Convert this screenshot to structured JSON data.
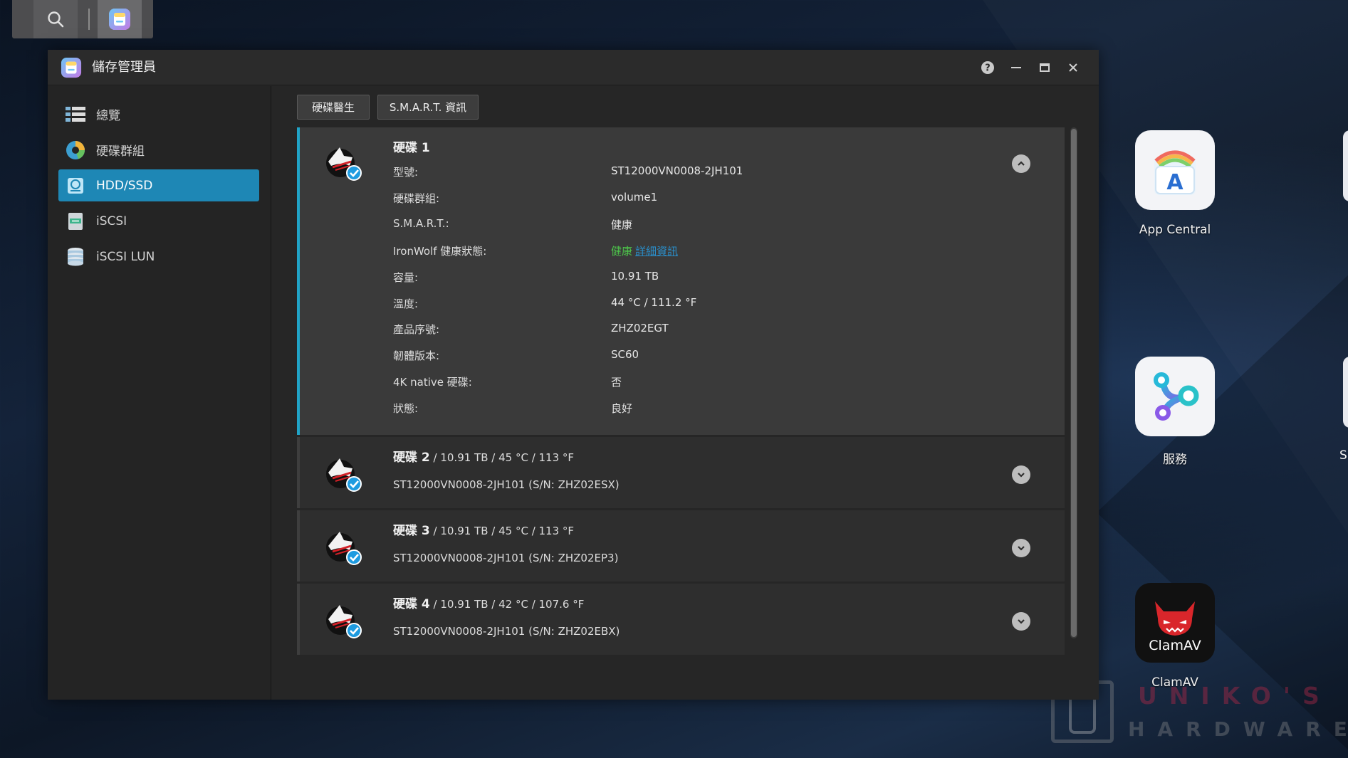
{
  "window": {
    "title": "儲存管理員",
    "controls": {
      "help": "?",
      "minimize": "–",
      "maximize": "▭",
      "close": "✕"
    }
  },
  "sidebar": {
    "items": [
      {
        "label": "總覽",
        "icon": "overview-icon",
        "active": false
      },
      {
        "label": "硬碟群組",
        "icon": "disk-group-icon",
        "active": false
      },
      {
        "label": "HDD/SSD",
        "icon": "hdd-ssd-icon",
        "active": true
      },
      {
        "label": "iSCSI",
        "icon": "iscsi-icon",
        "active": false
      },
      {
        "label": "iSCSI LUN",
        "icon": "iscsi-lun-icon",
        "active": false
      }
    ]
  },
  "toolbar": {
    "disk_doctor_label": "硬碟醫生",
    "smart_info_label": "S.M.A.R.T. 資訊"
  },
  "disks": {
    "disk1": {
      "title": "硬碟 1",
      "details": [
        {
          "key": "型號:",
          "value": "ST12000VN0008-2JH101"
        },
        {
          "key": "硬碟群組:",
          "value": "volume1"
        },
        {
          "key": "S.M.A.R.T.:",
          "value": "健康"
        },
        {
          "key": "IronWolf 健康狀態:",
          "value": "健康",
          "link": "詳細資訊"
        },
        {
          "key": "容量:",
          "value": "10.91 TB"
        },
        {
          "key": "溫度:",
          "value": "44 °C / 111.2 °F"
        },
        {
          "key": "產品序號:",
          "value": "ZHZ02EGT"
        },
        {
          "key": "韌體版本:",
          "value": "SC60"
        },
        {
          "key": "4K native 硬碟:",
          "value": "否"
        },
        {
          "key": "狀態:",
          "value": "良好"
        }
      ]
    },
    "disk2": {
      "title": "硬碟 2",
      "summary": " / 10.91 TB / 45 °C / 113 °F",
      "model": "ST12000VN0008-2JH101 (S/N: ZHZ02ESX)"
    },
    "disk3": {
      "title": "硬碟 3",
      "summary": " / 10.91 TB / 45 °C / 113 °F",
      "model": "ST12000VN0008-2JH101 (S/N: ZHZ02EP3)"
    },
    "disk4": {
      "title": "硬碟 4",
      "summary": " / 10.91 TB / 42 °C / 107.6 °F",
      "model": "ST12000VN0008-2JH101 (S/N: ZHZ02EBX)"
    }
  },
  "desktop": {
    "apps": [
      {
        "label": "App Central"
      },
      {
        "label": "服務"
      },
      {
        "label": "ClamAV",
        "tile_text": "ClamAV"
      }
    ],
    "edge_label": "S"
  },
  "watermark": {
    "line1": "UNIKO'S",
    "line2": "HARDWARE"
  },
  "colors": {
    "accent": "#1e87b5",
    "expanded_border": "#20a4c8",
    "healthy_green": "#4cc24a",
    "link_blue": "#2a8dc8"
  }
}
